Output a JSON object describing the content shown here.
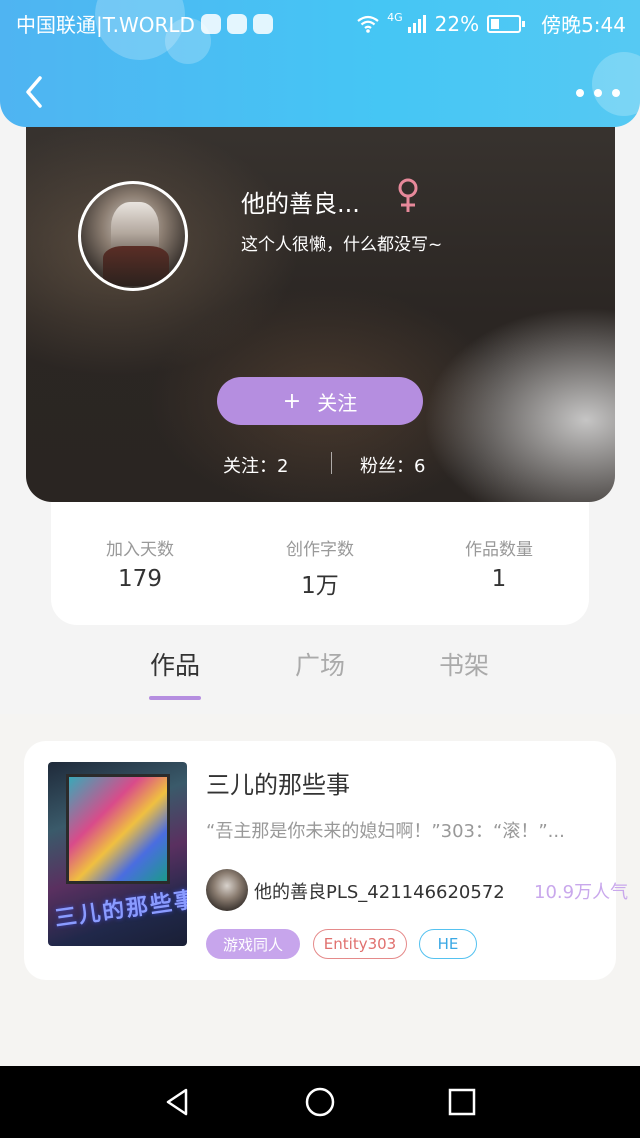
{
  "status_bar": {
    "carrier": "中国联通|T.WORLD",
    "network": "4G",
    "battery": "22%",
    "time": "傍晚5:44"
  },
  "profile": {
    "name": "他的善良...",
    "gender_icon": "female-symbol-icon",
    "bio": "这个人很懒，什么都没写~",
    "follow_button": "关注",
    "following_label": "关注：",
    "following_count": "2",
    "fans_label": "粉丝：",
    "fans_count": "6"
  },
  "stats": [
    {
      "label": "加入天数",
      "value": "179"
    },
    {
      "label": "创作字数",
      "value": "1万"
    },
    {
      "label": "作品数量",
      "value": "1"
    }
  ],
  "tabs": [
    {
      "label": "作品",
      "active": true
    },
    {
      "label": "广场",
      "active": false
    },
    {
      "label": "书架",
      "active": false
    }
  ],
  "work": {
    "title": "三儿的那些事",
    "description": "“吾主那是你未来的媳妇啊！”303：“滚！”...",
    "cover_text": "三儿的那些事",
    "author": "他的善良PLS_421146620572",
    "popularity": "10.9万人气",
    "tags": [
      "游戏同人",
      "Entity303",
      "HE"
    ]
  },
  "colors": {
    "header_blue": "#45c6f4",
    "accent_purple": "#b58ee0",
    "tag_red": "#e0706e",
    "tag_blue": "#3aa8e4"
  }
}
